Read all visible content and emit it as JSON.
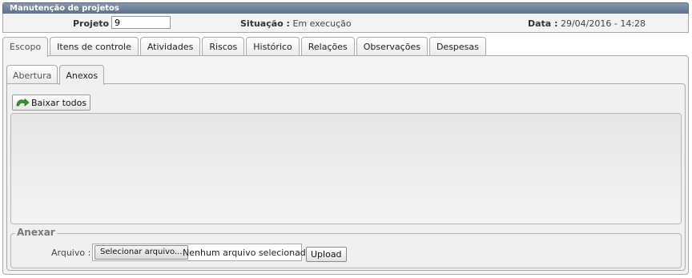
{
  "window": {
    "title": "Manutenção de projetos"
  },
  "info": {
    "projeto_label": "Projeto :",
    "projeto_value": "9",
    "situacao_label": "Situação :",
    "situacao_value": "Em execução",
    "data_label": "Data :",
    "data_value": "29/04/2016 - 14:28"
  },
  "tabs": [
    {
      "label": "Escopo",
      "active": true
    },
    {
      "label": "Itens de controle"
    },
    {
      "label": "Atividades"
    },
    {
      "label": "Riscos"
    },
    {
      "label": "Histórico"
    },
    {
      "label": "Relações"
    },
    {
      "label": "Observações"
    },
    {
      "label": "Despesas"
    }
  ],
  "subtabs": [
    {
      "label": "Abertura"
    },
    {
      "label": "Anexos",
      "active": true
    }
  ],
  "anexos": {
    "download_all_label": "Baixar todos",
    "download_icon": "download-arrow-icon",
    "files": []
  },
  "anexar": {
    "legend": "Anexar",
    "arquivo_label": "Arquivo :",
    "select_button": "Selecionar arquivo...",
    "no_file_text": "Nenhum arquivo selecionado.",
    "upload_button": "Upload"
  }
}
